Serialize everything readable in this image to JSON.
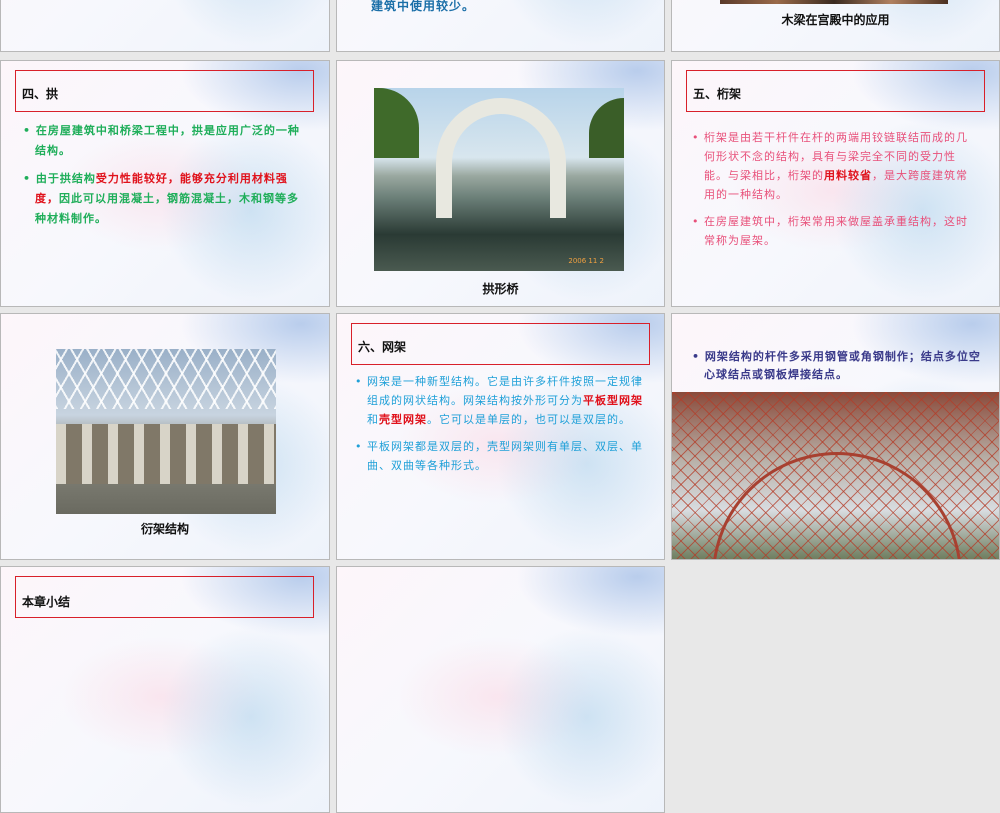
{
  "slides": [
    {
      "text": "建筑中使用较少。"
    },
    {
      "caption": "木梁在宫殿中的应用"
    },
    {
      "title": "四、拱",
      "bullets": [
        {
          "t": "在房屋建筑中和桥梁工程中，拱是应用广泛的一种结构。"
        },
        {
          "a": "由于拱结构",
          "r": "受力性能较好，能够充分利用材料强度，",
          "b": "因此可以用混凝土，钢筋混凝土，木和钢等多种材料制作。"
        }
      ]
    },
    {
      "caption": "拱形桥",
      "photo_stamp": "2006 11 2"
    },
    {
      "title": "五、桁架",
      "bullets": [
        {
          "a": "桁架是由若干杆件在杆的两端用铰链联结而成的几何形状不念的结构，具有与梁完全不同的受力性能。与梁相比，桁架的",
          "r": "用料较省",
          "b": "，是大跨度建筑常用的一种结构。"
        },
        {
          "t": "在房屋建筑中，桁架常用来做屋盖承重结构，这时常称为屋架。"
        }
      ]
    },
    {
      "caption": "衍架结构"
    },
    {
      "title": "六、网架",
      "bullets": [
        {
          "a": "网架是一种新型结构。它是由许多杆件按照一定规律组成的网状结构。网架结构按外形可分为",
          "r": "平板型网架",
          "m": "和",
          "r2": "壳型网架",
          "b": "。它可以是单层的，也可以是双层的。"
        },
        {
          "t": "平板网架都是双层的，壳型网架则有单层、双层、单曲、双曲等各种形式。"
        }
      ]
    },
    {
      "bullets": [
        {
          "t": "网架结构的杆件多采用钢管或角钢制作；结点多位空心球结点或钢板焊接结点。"
        }
      ]
    },
    {
      "title": "本章小结"
    },
    {}
  ],
  "colors": {
    "green": "#1fae5a",
    "pink": "#e8507a",
    "cyan": "#1fa0d8",
    "navy": "#3a3a8a",
    "red": "#e0121c",
    "teal": "#1b6fa8"
  }
}
